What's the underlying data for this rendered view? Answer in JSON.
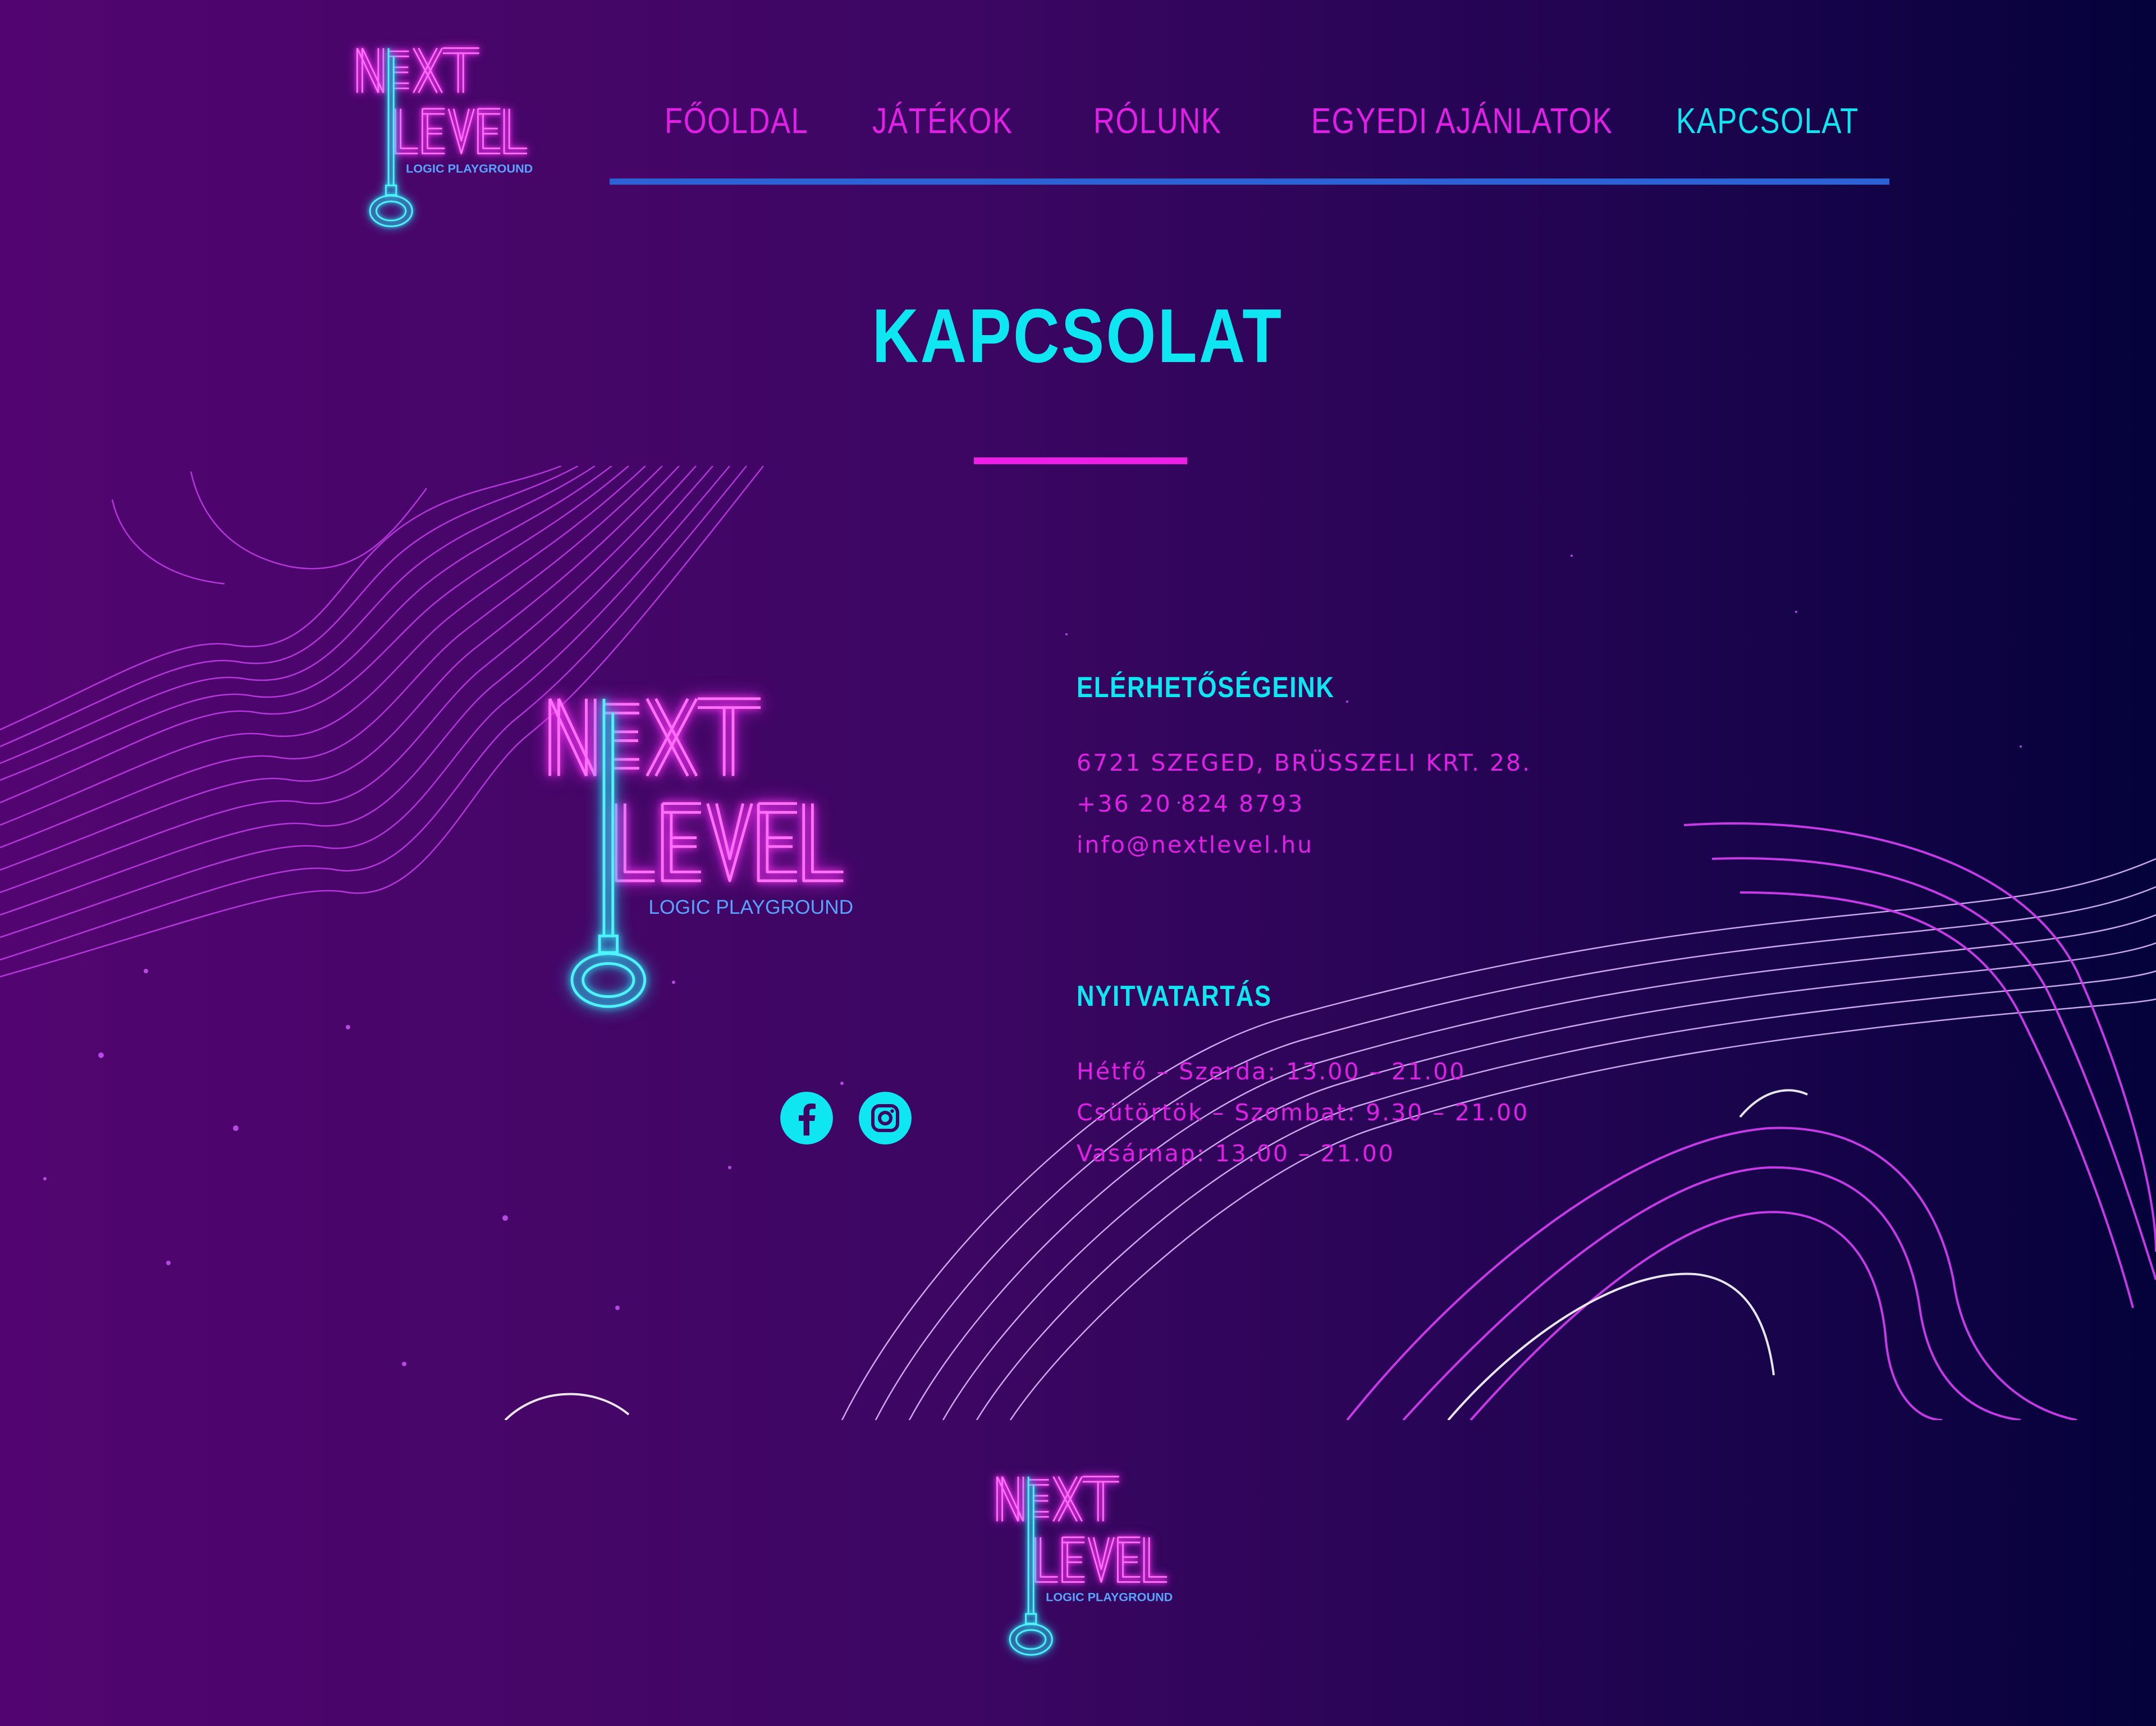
{
  "colors": {
    "accent_cyan": "#0ee6f2",
    "accent_pink": "#e21fe6",
    "nav_rule": "#2b63d6",
    "bg_left": "#520570",
    "bg_right": "#04023a"
  },
  "logo": {
    "name": "NEXT LEVEL",
    "word1": "NEXT",
    "word2": "LEVEL",
    "tagline": "LOGIC PLAYGROUND"
  },
  "nav": {
    "items": [
      {
        "label": "FŐOLDAL",
        "active": false
      },
      {
        "label": "JÁTÉKOK",
        "active": false
      },
      {
        "label": "RÓLUNK",
        "active": false
      },
      {
        "label": "EGYEDI AJÁNLATOK",
        "active": false
      },
      {
        "label": "KAPCSOLAT",
        "active": true
      }
    ]
  },
  "page": {
    "title": "KAPCSOLAT"
  },
  "contact": {
    "heading": "ELÉRHETŐSÉGEINK",
    "address": "6721 SZEGED, BRÜSSZELI KRT. 28.",
    "phone": "+36 20 824 8793",
    "email": "info@nextlevel.hu"
  },
  "hours": {
    "heading": "NYITVATARTÁS",
    "lines": [
      "Hétfő – Szerda: 13.00 – 21.00",
      "Csütörtök – Szombat: 9.30 – 21.00",
      "Vasárnap: 13.00 – 21.00"
    ]
  },
  "social": [
    {
      "icon": "facebook-icon"
    },
    {
      "icon": "instagram-icon"
    }
  ]
}
